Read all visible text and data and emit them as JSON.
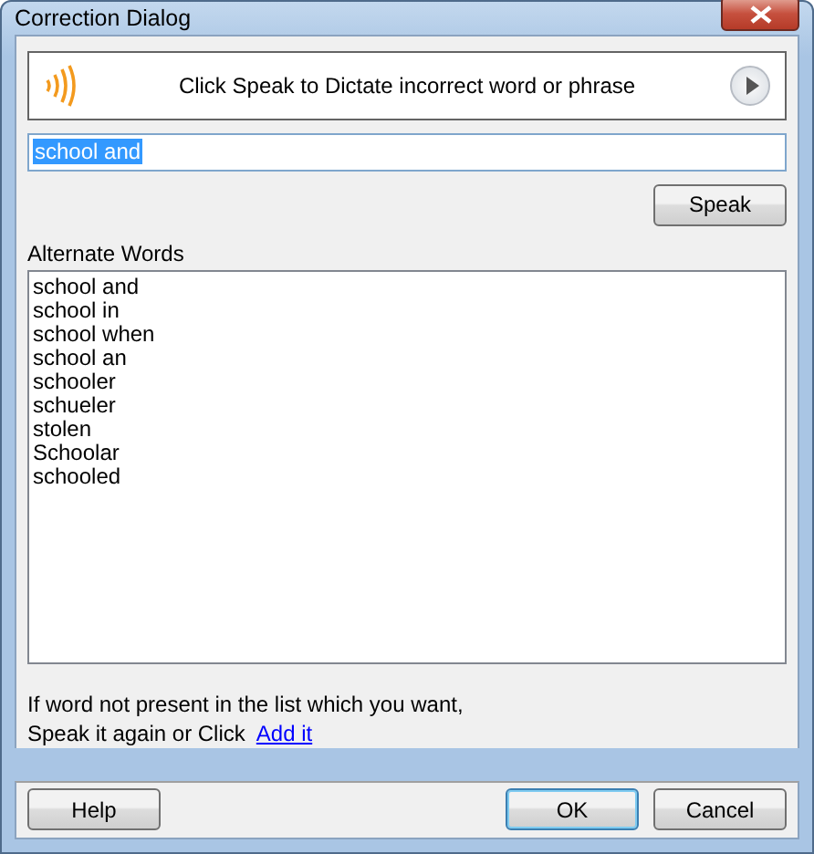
{
  "window": {
    "title": "Correction Dialog"
  },
  "banner": {
    "text": "Click Speak to Dictate incorrect word or phrase"
  },
  "input": {
    "value": "school and",
    "selected": true
  },
  "speak_button": "Speak",
  "list": {
    "label": "Alternate Words",
    "items": [
      {
        "text": "school and"
      },
      {
        "text": "school in"
      },
      {
        "text": "school when"
      },
      {
        "text": "school an"
      },
      {
        "text": "schooler"
      },
      {
        "text": "schueler"
      },
      {
        "text": "stolen"
      },
      {
        "text": "Schoolar"
      },
      {
        "text": "schooled"
      }
    ]
  },
  "hint": {
    "lines": [
      "If word not present in the list which you want,",
      "Speak it again or Click"
    ],
    "link": "Add it"
  },
  "buttons": [
    {
      "label": "Help",
      "default": false
    },
    {
      "label": "OK",
      "default": true
    },
    {
      "label": "Cancel",
      "default": false
    }
  ]
}
